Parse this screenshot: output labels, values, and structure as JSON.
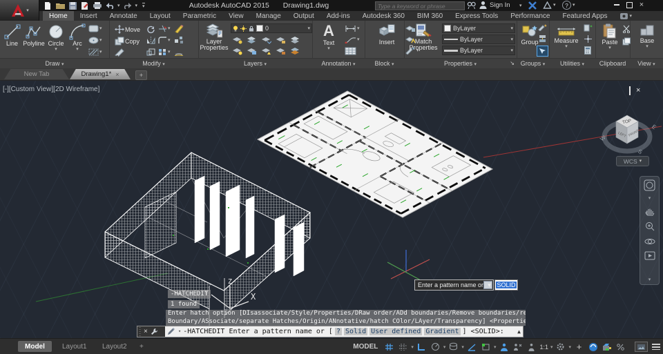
{
  "title_bar": {
    "title_app": "Autodesk AutoCAD 2015",
    "title_doc": "Drawing1.dwg",
    "search_placeholder": "Type a keyword or phrase",
    "sign_in": "Sign In"
  },
  "menu": {
    "tabs": [
      {
        "label": "Home",
        "active": true
      },
      {
        "label": "Insert"
      },
      {
        "label": "Annotate"
      },
      {
        "label": "Layout"
      },
      {
        "label": "Parametric"
      },
      {
        "label": "View"
      },
      {
        "label": "Manage"
      },
      {
        "label": "Output"
      },
      {
        "label": "Add-ins"
      },
      {
        "label": "Autodesk 360"
      },
      {
        "label": "BIM 360"
      },
      {
        "label": "Express Tools"
      },
      {
        "label": "Performance"
      },
      {
        "label": "Featured Apps"
      }
    ]
  },
  "ribbon": {
    "draw": {
      "tools": [
        "Line",
        "Polyline",
        "Circle",
        "Arc"
      ],
      "footer": "Draw"
    },
    "modify": {
      "tools": [
        "Move",
        "Copy"
      ],
      "footer": "Modify"
    },
    "layers": {
      "tool": "Layer Properties",
      "layer_value": "0",
      "footer": "Layers"
    },
    "annotation": {
      "tool": "Text",
      "footer": "Annotation"
    },
    "block": {
      "tool": "Insert",
      "footer": "Block"
    },
    "properties": {
      "tool": "Match Properties",
      "dropdowns": [
        "ByLayer",
        "ByLayer",
        "ByLayer"
      ],
      "footer": "Properties"
    },
    "groups": {
      "tool": "Group",
      "footer": "Groups"
    },
    "utilities": {
      "tool": "Measure",
      "footer": "Utilities"
    },
    "clipboard": {
      "tool": "Paste",
      "footer": "Clipboard"
    },
    "view": {
      "tool": "Base",
      "footer": "View"
    }
  },
  "file_tabs": {
    "tabs": [
      "New Tab",
      "Drawing1*"
    ]
  },
  "viewport": {
    "label": "[-][Custom View][2D Wireframe]",
    "viewcube": {
      "top": "TOP",
      "left": "LEFT",
      "front": "FRONT",
      "compass": [
        "W",
        "S",
        "E"
      ],
      "wcs": "WCS"
    }
  },
  "command": {
    "echo": "-HATCHEDIT",
    "found": "1 found",
    "prompt_line1": "Enter hatch option [DIsassociate/Style/Properties/DRaw order/ADd boundaries/Remove boundaries/recreate",
    "prompt_line2": "Boundary/ASsociate/separate Hatches/Origin/ANnotative/hatch COlor/LAyer/Transparency] <Properties>:",
    "tooltip": {
      "text": "Enter a pattern name or",
      "value": "SOLID"
    },
    "input": {
      "prefix": "-HATCHEDIT Enter a pattern name or [",
      "options": [
        "?",
        "Solid",
        "User defined",
        "Gradient"
      ],
      "suffix": "] <SOLID>:"
    }
  },
  "status_bar": {
    "layout_tabs": [
      "Model",
      "Layout1",
      "Layout2"
    ],
    "model_label": "MODEL",
    "scale": "1:1"
  },
  "icons": {
    "dropdown": "▾",
    "up_arrow": "▲",
    "plus": "+",
    "close": "×",
    "help": "?"
  },
  "colors": {
    "accent_blue": "#4d9fe8",
    "cad_red": "#c21d26",
    "selection_blue": "#2f6fd0",
    "canvas_bg": "#232933",
    "osnap_green": "#41c541"
  }
}
